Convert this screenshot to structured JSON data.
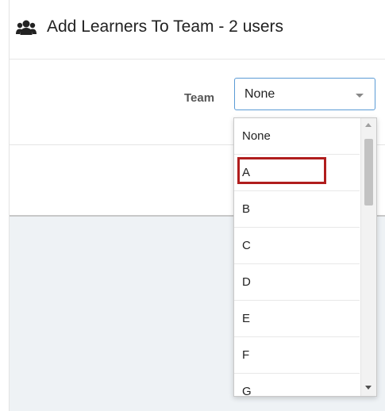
{
  "modal": {
    "title": "Add Learners To Team - 2 users",
    "title_icon": "users-icon"
  },
  "form": {
    "team_label": "Team",
    "team_selected": "None"
  },
  "dropdown": {
    "options": [
      "None",
      "A",
      "B",
      "C",
      "D",
      "E",
      "F",
      "G"
    ],
    "highlighted_option": "A",
    "highlight_color": "#b01d1d"
  },
  "colors": {
    "select_border": "#5b9bd5",
    "backdrop": "#eef2f5"
  }
}
